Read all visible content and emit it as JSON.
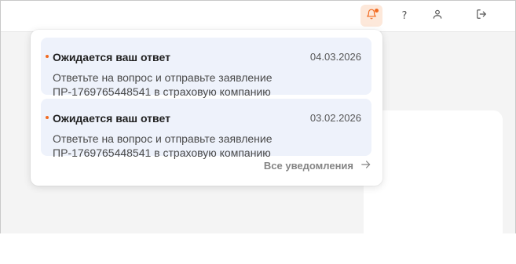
{
  "header": {
    "icons": [
      "bell-icon",
      "help-icon",
      "user-icon",
      "logout-icon"
    ],
    "help_glyph": "?"
  },
  "notifications": {
    "items": [
      {
        "title": "Ожидается ваш ответ",
        "date": "04.03.2026",
        "text": "Ответьте на вопрос и отправьте заявление ПР-1769765448541 в страховую компанию"
      },
      {
        "title": "Ожидается ваш ответ",
        "date": "03.02.2026",
        "text": "Ответьте на вопрос и отправьте заявление ПР-1769765448541 в страховую компанию"
      }
    ],
    "all_label": "Все уведомления"
  },
  "colors": {
    "accent": "#f26b21",
    "notification_bg": "#eef2fb",
    "bell_active_bg": "#fde8da"
  }
}
